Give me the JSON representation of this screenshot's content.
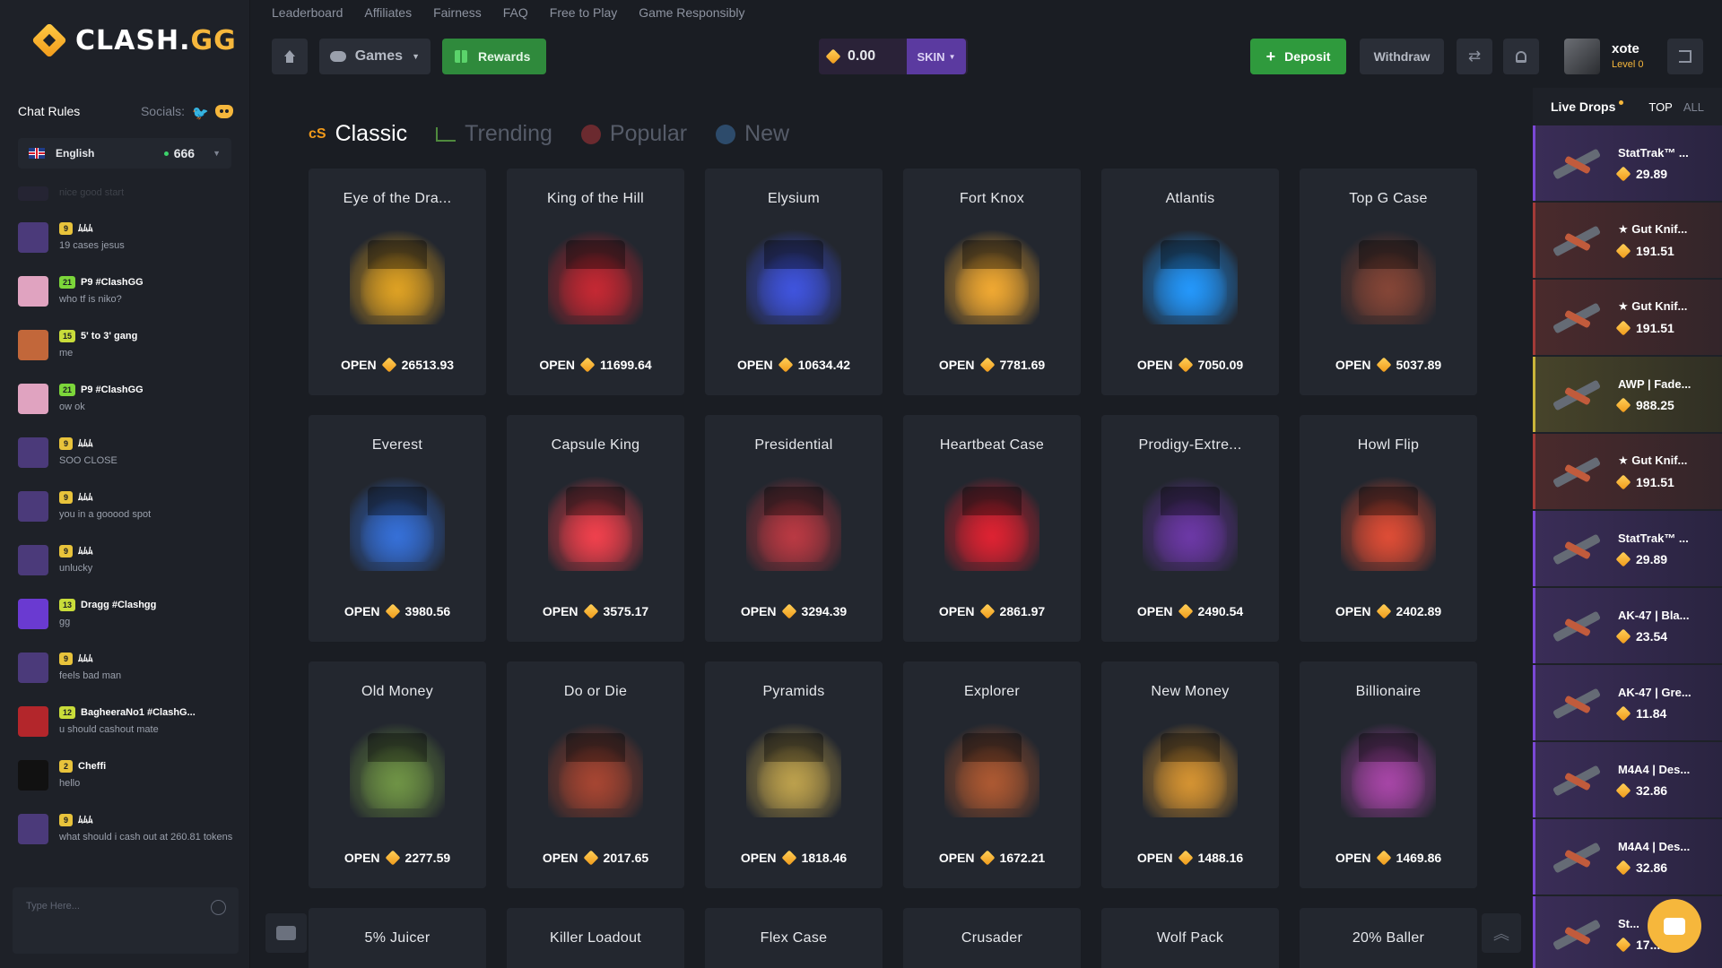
{
  "brand": {
    "name_main": "CLASH.",
    "name_suffix": "GG"
  },
  "topnav": [
    "Leaderboard",
    "Affiliates",
    "Fairness",
    "FAQ",
    "Free to Play",
    "Game Responsibly"
  ],
  "toolbar": {
    "games_label": "Games",
    "rewards_label": "Rewards",
    "balance": "0.00",
    "currency": "SKIN",
    "deposit_label": "Deposit",
    "withdraw_label": "Withdraw",
    "username": "xote",
    "level": "Level 0"
  },
  "chat": {
    "rules_label": "Chat Rules",
    "socials_label": "Socials:",
    "language": "English",
    "online": "666",
    "input_placeholder": "Type Here...",
    "messages": [
      {
        "level": "",
        "user": "",
        "text": "nice good start",
        "avatar": "#3a2f55"
      },
      {
        "level": "9",
        "user": "ﾑﾑﾑ",
        "text": "19 cases jesus",
        "avatar": "#4b3a7a"
      },
      {
        "level": "21",
        "user": "P9 #ClashGG",
        "text": "who tf is niko?",
        "avatar": "#e0a3c0"
      },
      {
        "level": "15",
        "user": "5' to 3' gang",
        "text": "me",
        "avatar": "#c2673a"
      },
      {
        "level": "21",
        "user": "P9 #ClashGG",
        "text": "ow ok",
        "avatar": "#e0a3c0"
      },
      {
        "level": "9",
        "user": "ﾑﾑﾑ",
        "text": "SOO CLOSE",
        "avatar": "#4b3a7a"
      },
      {
        "level": "9",
        "user": "ﾑﾑﾑ",
        "text": "you in a gooood spot",
        "avatar": "#4b3a7a"
      },
      {
        "level": "9",
        "user": "ﾑﾑﾑ",
        "text": "unlucky",
        "avatar": "#4b3a7a"
      },
      {
        "level": "13",
        "user": "Dragg #Clashgg",
        "text": "gg",
        "avatar": "#6a3ad1"
      },
      {
        "level": "9",
        "user": "ﾑﾑﾑ",
        "text": "feels bad man",
        "avatar": "#4b3a7a"
      },
      {
        "level": "12",
        "user": "BagheeraNo1 #ClashG...",
        "text": "u should cashout mate",
        "avatar": "#b3262b"
      },
      {
        "level": "2",
        "user": "Cheffi",
        "text": "hello",
        "avatar": "#111111"
      },
      {
        "level": "9",
        "user": "ﾑﾑﾑ",
        "text": "what should i cash out at 260.81 tokens",
        "avatar": "#4b3a7a"
      }
    ]
  },
  "tabs": [
    "Classic",
    "Trending",
    "Popular",
    "New"
  ],
  "open_label": "OPEN",
  "cases": [
    {
      "name": "Eye of the Dra...",
      "price": "26513.93",
      "color": "#b8861e"
    },
    {
      "name": "King of the Hill",
      "price": "11699.64",
      "color": "#a3222b"
    },
    {
      "name": "Elysium",
      "price": "10634.42",
      "color": "#3546b8"
    },
    {
      "name": "Fort Knox",
      "price": "7781.69",
      "color": "#c78c2a"
    },
    {
      "name": "Atlantis",
      "price": "7050.09",
      "color": "#1e7ed1"
    },
    {
      "name": "Top G Case",
      "price": "5037.89",
      "color": "#6e3a2e"
    },
    {
      "name": "Everest",
      "price": "3980.56",
      "color": "#2d5db3"
    },
    {
      "name": "Capsule King",
      "price": "3575.17",
      "color": "#c73640"
    },
    {
      "name": "Presidential",
      "price": "3294.39",
      "color": "#9a3038"
    },
    {
      "name": "Heartbeat Case",
      "price": "2861.97",
      "color": "#b81d2a"
    },
    {
      "name": "Prodigy-Extre...",
      "price": "2490.54",
      "color": "#5a2f8a"
    },
    {
      "name": "Howl Flip",
      "price": "2402.89",
      "color": "#b8402d"
    },
    {
      "name": "Old Money",
      "price": "2277.59",
      "color": "#5c7a3a"
    },
    {
      "name": "Do or Die",
      "price": "2017.65",
      "color": "#8a3a2a"
    },
    {
      "name": "Pyramids",
      "price": "1818.46",
      "color": "#9c8540"
    },
    {
      "name": "Explorer",
      "price": "1672.21",
      "color": "#8f4a2a"
    },
    {
      "name": "New Money",
      "price": "1488.16",
      "color": "#b07a2a"
    },
    {
      "name": "Billionaire",
      "price": "1469.86",
      "color": "#8a3a8a"
    },
    {
      "name": "5% Juicer",
      "price": "",
      "color": ""
    },
    {
      "name": "Killer Loadout",
      "price": "",
      "color": ""
    },
    {
      "name": "Flex Case",
      "price": "",
      "color": ""
    },
    {
      "name": "Crusader",
      "price": "",
      "color": ""
    },
    {
      "name": "Wolf Pack",
      "price": "",
      "color": ""
    },
    {
      "name": "20% Baller",
      "price": "",
      "color": ""
    }
  ],
  "live_drops": {
    "title": "Live Drops",
    "filter_top": "TOP",
    "filter_all": "ALL",
    "items": [
      {
        "name": "StatTrak™ ...",
        "value": "29.89",
        "rarity": "purple"
      },
      {
        "name": "★ Gut Knif...",
        "value": "191.51",
        "rarity": "red"
      },
      {
        "name": "★ Gut Knif...",
        "value": "191.51",
        "rarity": "red"
      },
      {
        "name": "AWP | Fade...",
        "value": "988.25",
        "rarity": "yellow"
      },
      {
        "name": "★ Gut Knif...",
        "value": "191.51",
        "rarity": "red"
      },
      {
        "name": "StatTrak™ ...",
        "value": "29.89",
        "rarity": "purple"
      },
      {
        "name": "AK-47 | Bla...",
        "value": "23.54",
        "rarity": "purple"
      },
      {
        "name": "AK-47 | Gre...",
        "value": "11.84",
        "rarity": "purple"
      },
      {
        "name": "M4A4 | Des...",
        "value": "32.86",
        "rarity": "purple"
      },
      {
        "name": "M4A4 | Des...",
        "value": "32.86",
        "rarity": "purple"
      },
      {
        "name": "St...",
        "value": "17...",
        "rarity": "purple"
      }
    ]
  }
}
